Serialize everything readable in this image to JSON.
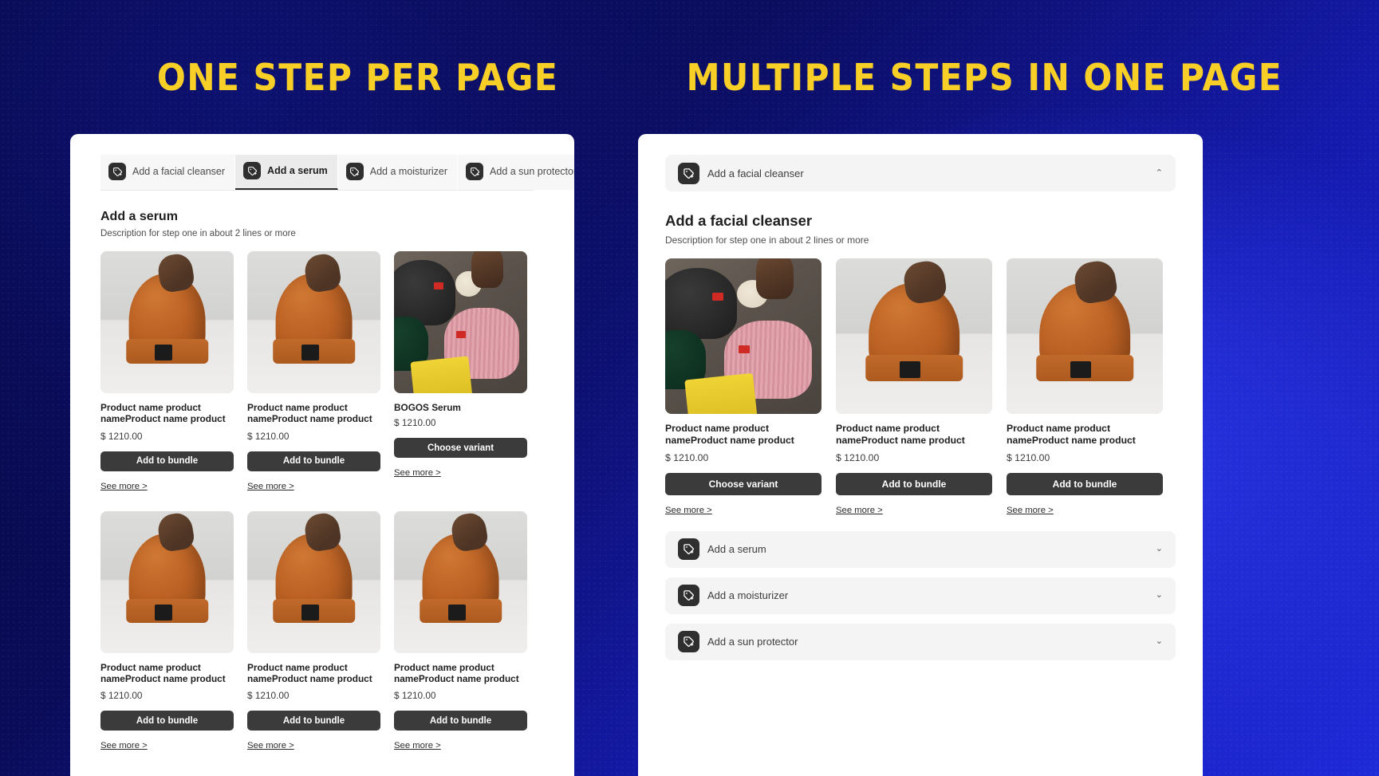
{
  "theme": {
    "accent_yellow": "#F7CF26",
    "panel_bg": "#FFFFFF",
    "button_dark": "#3B3B3B",
    "chip_dark": "#2F2F2F",
    "accordion_bg": "#F4F4F4",
    "tab_bg": "#F7F7F7",
    "tab_active_bg": "#EBEBEB"
  },
  "headline_left": "ONE STEP PER PAGE",
  "headline_right": "MULTIPLE STEPS IN ONE PAGE",
  "left_panel": {
    "tabs": [
      {
        "label": "Add a facial cleanser",
        "icon": "tag-plus-icon",
        "active": false
      },
      {
        "label": "Add a serum",
        "icon": "tag-plus-icon",
        "active": true
      },
      {
        "label": "Add a moisturizer",
        "icon": "tag-plus-icon",
        "active": false
      },
      {
        "label": "Add a sun protector",
        "icon": "tag-plus-icon",
        "active": false
      }
    ],
    "nav": {
      "prev_icon": "arrow-left-icon",
      "prev_glyph": "←",
      "next_icon": "arrow-right-icon",
      "next_glyph": "→"
    },
    "section_title": "Add a serum",
    "section_desc": "Description for step one in about 2 lines or more",
    "products": [
      {
        "name": "Product name product nameProduct name product nam…",
        "price": "$ 1210.00",
        "button": "Add to bundle",
        "more": "See more >",
        "image": "beanie-orange-held"
      },
      {
        "name": "Product name product nameProduct name product nam…",
        "price": "$ 1210.00",
        "button": "Add to bundle",
        "more": "See more >",
        "image": "beanie-orange-held"
      },
      {
        "name": "BOGOS Serum",
        "price": "$ 1210.00",
        "button": "Choose variant",
        "more": "See more >",
        "image": "beanie-flatlay"
      },
      {
        "name": "Product name product nameProduct name product nam…",
        "price": "$ 1210.00",
        "button": "Add to bundle",
        "more": "See more >",
        "image": "beanie-orange-held"
      },
      {
        "name": "Product name product nameProduct name product nam…",
        "price": "$ 1210.00",
        "button": "Add to bundle",
        "more": "See more >",
        "image": "beanie-orange-held"
      },
      {
        "name": "Product name product nameProduct name product nam…",
        "price": "$ 1210.00",
        "button": "Add to bundle",
        "more": "See more >",
        "image": "beanie-orange-held"
      }
    ]
  },
  "right_panel": {
    "open_step": {
      "label": "Add a facial cleanser",
      "icon": "tag-plus-icon",
      "chevron": "⌃",
      "expanded": true
    },
    "section_title": "Add a facial cleanser",
    "section_desc": "Description for step one in about 2 lines or more",
    "products": [
      {
        "name": "Product name product nameProduct name product nam…",
        "price": "$ 1210.00",
        "button": "Choose variant",
        "more": "See more >",
        "image": "beanie-flatlay"
      },
      {
        "name": "Product name product nameProduct name product nam…",
        "price": "$ 1210.00",
        "button": "Add to bundle",
        "more": "See more >",
        "image": "beanie-orange-held"
      },
      {
        "name": "Product name product nameProduct name product nam…",
        "price": "$ 1210.00",
        "button": "Add to bundle",
        "more": "See more >",
        "image": "beanie-orange-held"
      }
    ],
    "collapsed_steps": [
      {
        "label": "Add a serum",
        "icon": "tag-plus-icon",
        "chevron": "⌄"
      },
      {
        "label": "Add a moisturizer",
        "icon": "tag-plus-icon",
        "chevron": "⌄"
      },
      {
        "label": "Add a sun protector",
        "icon": "tag-plus-icon",
        "chevron": "⌄"
      }
    ]
  }
}
